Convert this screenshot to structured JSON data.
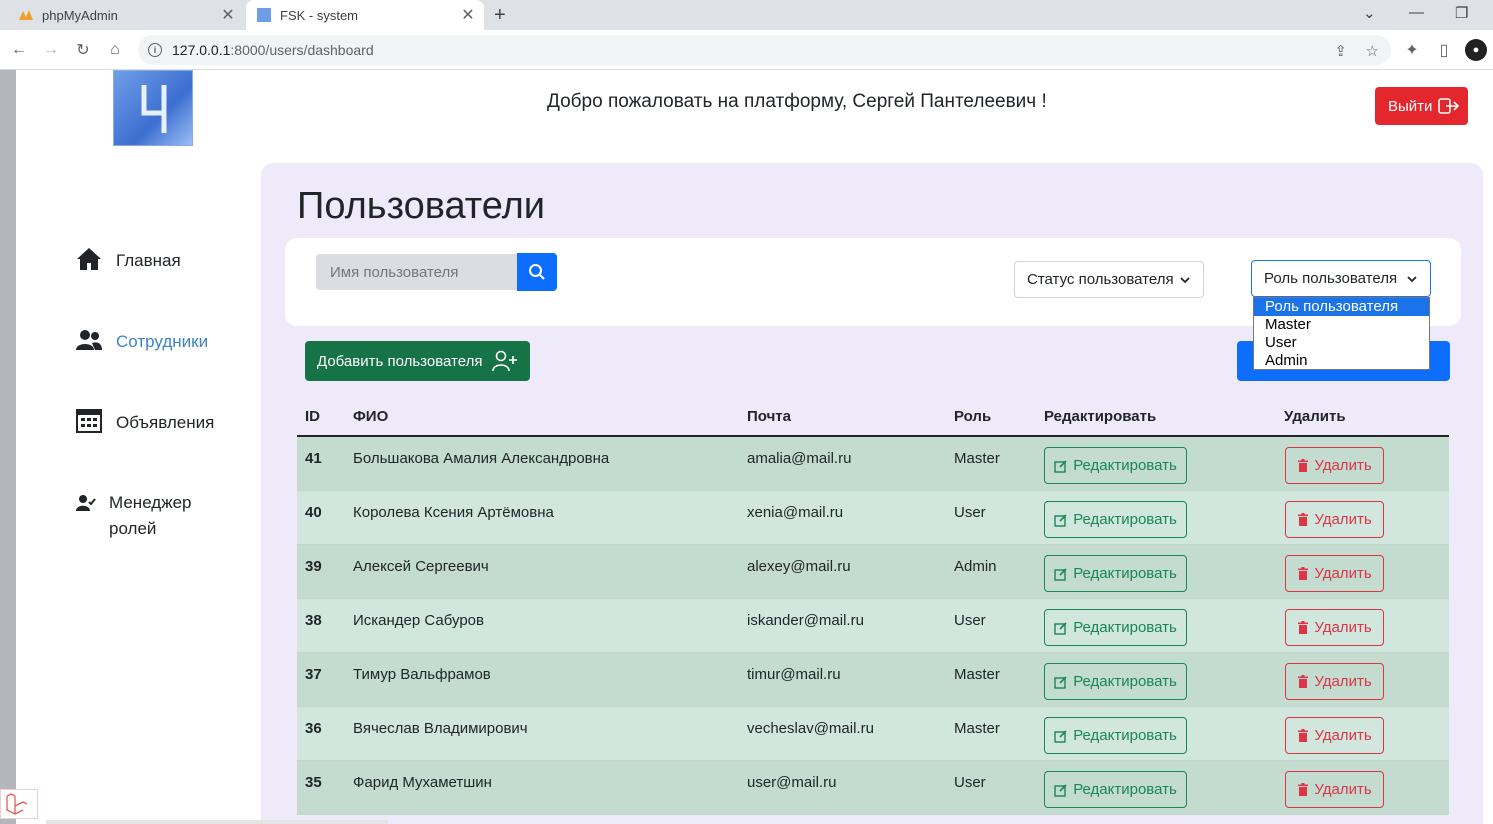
{
  "browser": {
    "tabs": [
      {
        "title": "phpMyAdmin",
        "active": false
      },
      {
        "title": "FSK - system",
        "active": true
      }
    ],
    "url_host": "127.0.0.1",
    "url_path": ":8000/users/dashboard"
  },
  "header": {
    "welcome": "Добро пожаловать на платформу, Сергей Пантелеевич !",
    "logout_label": "Выйти"
  },
  "sidebar": {
    "items": [
      {
        "label": "Главная",
        "icon": "home-icon",
        "active": false
      },
      {
        "label": "Сотрудники",
        "icon": "users-icon",
        "active": true
      },
      {
        "label": "Объявления",
        "icon": "calendar-icon",
        "active": false
      },
      {
        "label": "Менеджер ролей",
        "icon": "user-check-icon",
        "active": false
      }
    ]
  },
  "main": {
    "title": "Пользователи",
    "search_placeholder": "Имя пользователя",
    "status_select": "Статус пользователя",
    "role_select": "Роль пользователя",
    "role_options": [
      "Роль пользователя",
      "Master",
      "User",
      "Admin"
    ],
    "add_user_label": "Добавить пользователя"
  },
  "table": {
    "headers": [
      "ID",
      "ФИО",
      "Почта",
      "Роль",
      "Редактировать",
      "Удалить"
    ],
    "edit_label": "Редактировать",
    "delete_label": "Удалить",
    "rows": [
      {
        "id": "41",
        "fio": "Большакова Амалия Александровна",
        "email": "amalia@mail.ru",
        "role": "Master"
      },
      {
        "id": "40",
        "fio": "Королева Ксения Артёмовна",
        "email": "xenia@mail.ru",
        "role": "User"
      },
      {
        "id": "39",
        "fio": "Алексей Сергеевич",
        "email": "alexey@mail.ru",
        "role": "Admin"
      },
      {
        "id": "38",
        "fio": "Искандер Сабуров",
        "email": "iskander@mail.ru",
        "role": "User"
      },
      {
        "id": "37",
        "fio": "Тимур Вальфрамов",
        "email": "timur@mail.ru",
        "role": "Master"
      },
      {
        "id": "36",
        "fio": "Вячеслав Владимирович",
        "email": "vecheslav@mail.ru",
        "role": "Master"
      },
      {
        "id": "35",
        "fio": "Фарид Мухаметшин",
        "email": "user@mail.ru",
        "role": "User"
      }
    ]
  },
  "colors": {
    "accent": "#0d6efd",
    "danger": "#e4262d",
    "success": "#157347",
    "panel": "#eeeaf9"
  }
}
